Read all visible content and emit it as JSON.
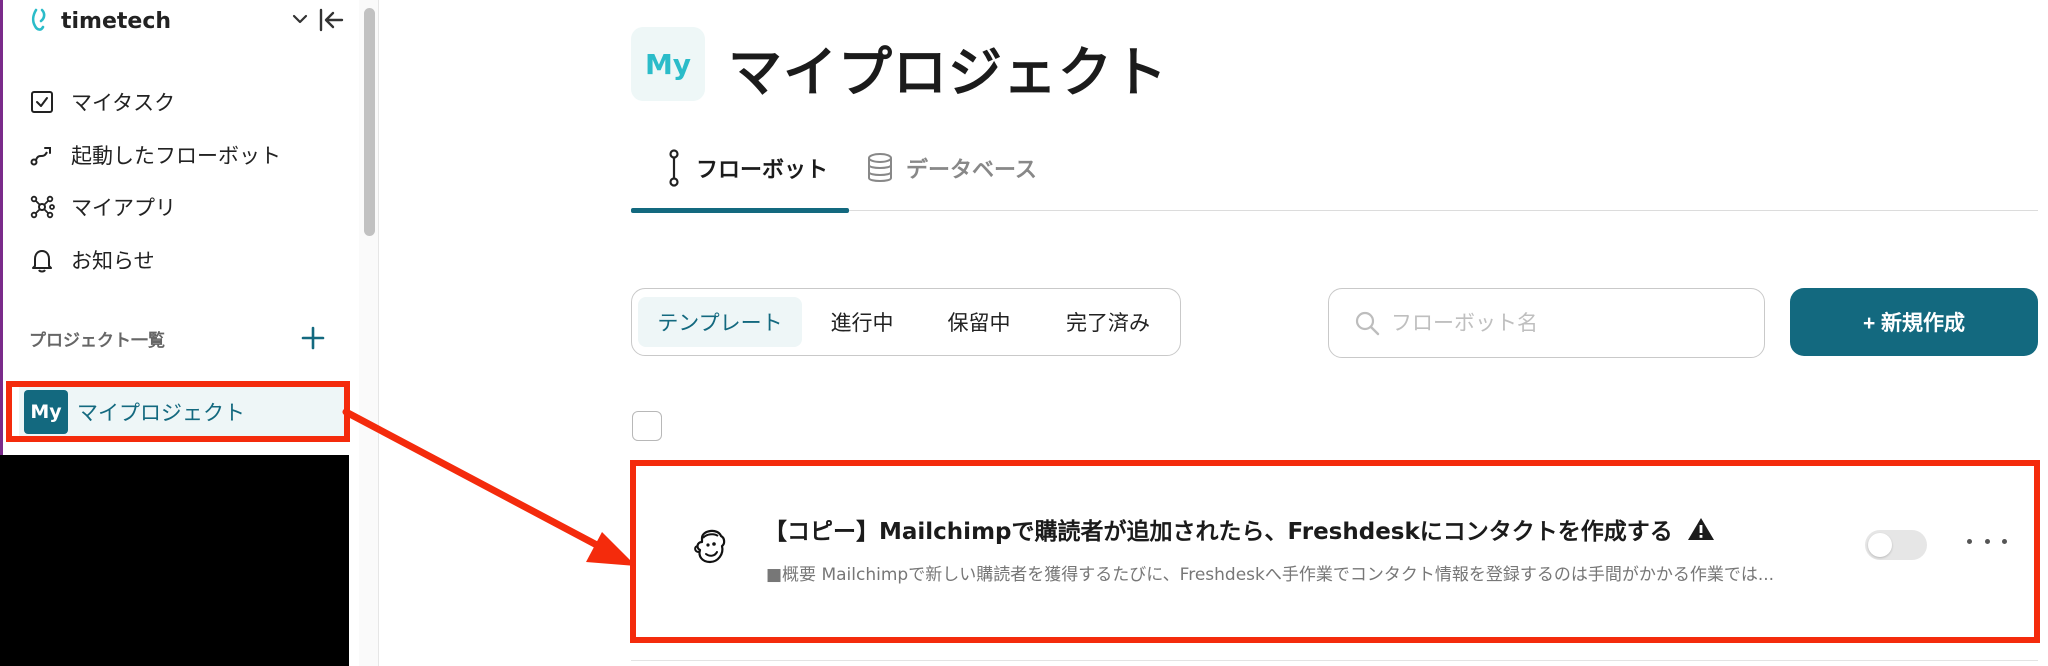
{
  "brand": {
    "name": "timetech"
  },
  "sidebar": {
    "items": [
      {
        "label": "マイタスク",
        "icon": "checkbox-icon"
      },
      {
        "label": "起動したフローボット",
        "icon": "flow-icon"
      },
      {
        "label": "マイアプリ",
        "icon": "apps-network-icon"
      },
      {
        "label": "お知らせ",
        "icon": "bell-icon"
      }
    ],
    "section_label": "プロジェクト一覧",
    "project": {
      "avatar": "My",
      "name": "マイプロジェクト"
    }
  },
  "header": {
    "avatar": "My",
    "title": "マイプロジェクト"
  },
  "tabs": [
    {
      "label": "フローボット",
      "active": true
    },
    {
      "label": "データベース",
      "active": false
    }
  ],
  "filters": {
    "options": [
      "テンプレート",
      "進行中",
      "保留中",
      "完了済み"
    ],
    "selected": "テンプレート"
  },
  "search": {
    "placeholder": "フローボット名",
    "value": ""
  },
  "create_button": "+ 新規作成",
  "flows": [
    {
      "title": "【コピー】Mailchimpで購読者が追加されたら、Freshdeskにコンタクトを作成する",
      "description": "■概要 Mailchimpで新しい購読者を獲得するたびに、Freshdeskへ手作業でコンタクト情報を登録するのは手間がかかる作業では...",
      "enabled": false,
      "warning": true
    }
  ],
  "colors": {
    "accent": "#13697f",
    "annotation": "#f42b0c",
    "avatar_text": "#2bbcc9"
  }
}
